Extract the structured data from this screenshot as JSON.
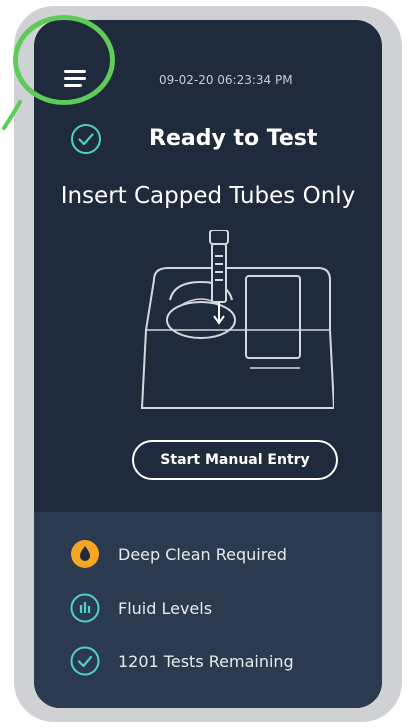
{
  "header": {
    "menu_icon": "hamburger-menu-icon",
    "timestamp": "09-02-20 06:23:34 PM"
  },
  "status": {
    "icon": "check-circle-icon",
    "title": "Ready to Test",
    "instruction": "Insert Capped Tubes Only"
  },
  "illustration": {
    "icon": "insert-tube-device-illustration"
  },
  "actions": {
    "manual_entry_label": "Start Manual Entry"
  },
  "status_panel": {
    "items": [
      {
        "icon": "droplet-icon",
        "label": "Deep Clean Required",
        "color": "#f5a623"
      },
      {
        "icon": "bar-chart-icon",
        "label": "Fluid Levels",
        "color": "#4fd1c5"
      },
      {
        "icon": "check-circle-icon",
        "label": "1201 Tests Remaining",
        "color": "#4fd1c5"
      }
    ]
  },
  "colors": {
    "screen_background": "#1f2a3c",
    "panel_background": "#2c3a4f",
    "accent_teal": "#4fd1c5",
    "warning_orange": "#f5a623",
    "annotation_green": "#5dcb55"
  }
}
